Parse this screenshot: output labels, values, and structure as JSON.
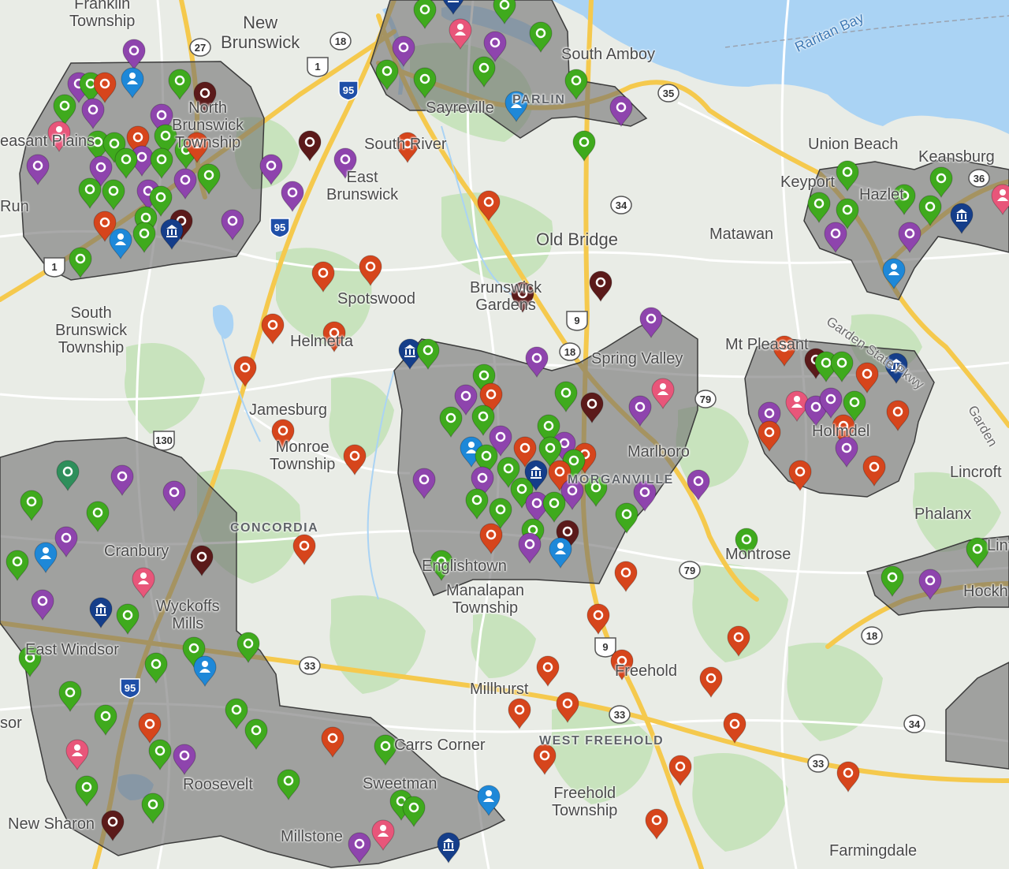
{
  "colors": {
    "land": "#e9ece6",
    "green_area": "#c8e3bd",
    "water": "#aad3f4",
    "region_fill": "#6f6f6f",
    "region_stroke": "#3c3c3c",
    "highway": "#f5c94d",
    "road": "#ffffff",
    "pin_green": "#3faa1d",
    "pin_purple": "#8e44ad",
    "pin_orange": "#d6451c",
    "pin_maroon": "#5b1a1a",
    "pin_navy": "#153e8a",
    "pin_blue": "#1e88d8",
    "pin_pink": "#e8567a",
    "pin_teal": "#2e8f5b"
  },
  "places": [
    {
      "id": "franklin-township",
      "label": "Franklin\nTownship"
    },
    {
      "id": "new-brunswick",
      "label": "New\nBrunswick"
    },
    {
      "id": "raritan-bay",
      "label": "Raritan Bay"
    },
    {
      "id": "south-amboy",
      "label": "South Amboy"
    },
    {
      "id": "parlin",
      "label": "PARLIN"
    },
    {
      "id": "sayreville",
      "label": "Sayreville"
    },
    {
      "id": "north-brunswick",
      "label": "North\nBrunswick\nTownship"
    },
    {
      "id": "pleasant-plains",
      "label": "easant Plains"
    },
    {
      "id": "south-river",
      "label": "South River"
    },
    {
      "id": "east-brunswick",
      "label": "East\nBrunswick"
    },
    {
      "id": "union-beach",
      "label": "Union Beach"
    },
    {
      "id": "keansburg",
      "label": "Keansburg"
    },
    {
      "id": "keyport",
      "label": "Keyport"
    },
    {
      "id": "hazlet",
      "label": "Hazlet"
    },
    {
      "id": "run",
      "label": "Run"
    },
    {
      "id": "old-bridge",
      "label": "Old Bridge"
    },
    {
      "id": "matawan",
      "label": "Matawan"
    },
    {
      "id": "spotswood",
      "label": "Spotswood"
    },
    {
      "id": "brunswick-gardens",
      "label": "Brunswick\nGardens"
    },
    {
      "id": "south-brunswick",
      "label": "South\nBrunswick\nTownship"
    },
    {
      "id": "helmetta",
      "label": "Helmetta"
    },
    {
      "id": "mt-pleasant",
      "label": "Mt Pleasant"
    },
    {
      "id": "spring-valley",
      "label": "Spring Valley"
    },
    {
      "id": "garden-state-pkwy",
      "label": "Garden State Pkwy"
    },
    {
      "id": "jamesburg",
      "label": "Jamesburg"
    },
    {
      "id": "holmdel",
      "label": "Holmdel"
    },
    {
      "id": "garden",
      "label": "Garden"
    },
    {
      "id": "marlboro",
      "label": "Marlboro"
    },
    {
      "id": "monroe-township",
      "label": "Monroe\nTownship"
    },
    {
      "id": "morganville",
      "label": "MORGANVILLE"
    },
    {
      "id": "lincroft",
      "label": "Lincroft"
    },
    {
      "id": "concordia",
      "label": "CONCORDIA"
    },
    {
      "id": "phalanx",
      "label": "Phalanx"
    },
    {
      "id": "cranbury",
      "label": "Cranbury"
    },
    {
      "id": "englishtown",
      "label": "Englishtown"
    },
    {
      "id": "montrose",
      "label": "Montrose"
    },
    {
      "id": "manalapan",
      "label": "Manalapan\nTownship"
    },
    {
      "id": "hockh",
      "label": "Hockh"
    },
    {
      "id": "lint",
      "label": "Lint"
    },
    {
      "id": "wyckoffs-mills",
      "label": "Wyckoffs\nMills"
    },
    {
      "id": "east-windsor",
      "label": "East Windsor"
    },
    {
      "id": "freehold",
      "label": "Freehold"
    },
    {
      "id": "millhurst",
      "label": "Millhurst"
    },
    {
      "id": "sor",
      "label": "sor"
    },
    {
      "id": "west-freehold",
      "label": "WEST FREEHOLD"
    },
    {
      "id": "carrs-corner",
      "label": "Carrs Corner"
    },
    {
      "id": "freehold-township",
      "label": "Freehold\nTownship"
    },
    {
      "id": "roosevelt",
      "label": "Roosevelt"
    },
    {
      "id": "sweetman",
      "label": "Sweetman"
    },
    {
      "id": "new-sharon",
      "label": "New Sharon"
    },
    {
      "id": "millstone",
      "label": "Millstone"
    },
    {
      "id": "farmingdale",
      "label": "Farmingdale"
    }
  ],
  "route_shields": [
    {
      "id": "rt-27",
      "label": "27",
      "kind": "state"
    },
    {
      "id": "rt-18a",
      "label": "18",
      "kind": "state"
    },
    {
      "id": "rt-1a",
      "label": "1",
      "kind": "us"
    },
    {
      "id": "i-95a",
      "label": "95",
      "kind": "interstate"
    },
    {
      "id": "rt-35",
      "label": "35",
      "kind": "state"
    },
    {
      "id": "rt-36",
      "label": "36",
      "kind": "state"
    },
    {
      "id": "rt-34a",
      "label": "34",
      "kind": "state"
    },
    {
      "id": "i-95b",
      "label": "95",
      "kind": "interstate"
    },
    {
      "id": "rt-1b",
      "label": "1",
      "kind": "us"
    },
    {
      "id": "rt-9a",
      "label": "9",
      "kind": "us"
    },
    {
      "id": "rt-18b",
      "label": "18",
      "kind": "state"
    },
    {
      "id": "rt-79a",
      "label": "79",
      "kind": "state"
    },
    {
      "id": "rt-130",
      "label": "130",
      "kind": "us"
    },
    {
      "id": "rt-79b",
      "label": "79",
      "kind": "state"
    },
    {
      "id": "rt-18c",
      "label": "18",
      "kind": "state"
    },
    {
      "id": "rt-9b",
      "label": "9",
      "kind": "us"
    },
    {
      "id": "rt-33a",
      "label": "33",
      "kind": "state"
    },
    {
      "id": "i-95c",
      "label": "95",
      "kind": "interstate"
    },
    {
      "id": "rt-33b",
      "label": "33",
      "kind": "state"
    },
    {
      "id": "rt-34b",
      "label": "34",
      "kind": "state"
    },
    {
      "id": "rt-33c",
      "label": "33",
      "kind": "state"
    }
  ],
  "marker_legend": {
    "green": "dot",
    "purple": "dot",
    "orange": "dot",
    "maroon": "dot",
    "navy": "bank-icon",
    "blue": "person-icon",
    "pink": "person-icon",
    "teal": "dot"
  }
}
